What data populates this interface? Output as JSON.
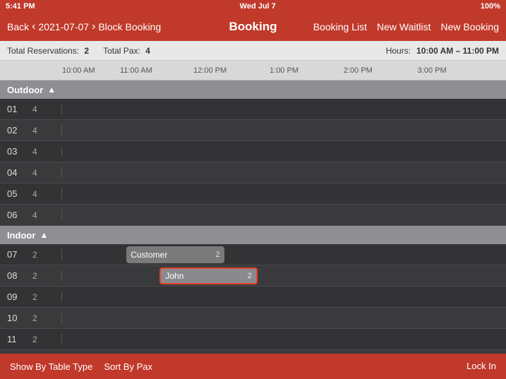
{
  "statusBar": {
    "time": "5:41 PM",
    "day": "Wed Jul 7",
    "signal": "WiFi",
    "battery": "100%"
  },
  "navBar": {
    "back": "Back",
    "date": "2021-07-07",
    "blockBooking": "Block Booking",
    "title": "Booking",
    "bookingList": "Booking List",
    "newWaitlist": "New Waitlist",
    "newBooking": "New Booking"
  },
  "infoBar": {
    "totalReservationsLabel": "Total Reservations:",
    "totalReservations": "2",
    "totalPaxLabel": "Total Pax:",
    "totalPax": "4",
    "hoursLabel": "Hours:",
    "hours": "10:00 AM – 11:00 PM"
  },
  "timelineHeader": {
    "times": [
      "10:00 AM",
      "11:00 AM",
      "12:00 PM",
      "1:00 PM",
      "2:00 PM",
      "3:00 PM"
    ]
  },
  "sections": [
    {
      "name": "Outdoor",
      "tables": [
        {
          "num": "01",
          "pax": 4,
          "bookings": []
        },
        {
          "num": "02",
          "pax": 4,
          "bookings": []
        },
        {
          "num": "03",
          "pax": 4,
          "bookings": []
        },
        {
          "num": "04",
          "pax": 4,
          "bookings": []
        },
        {
          "num": "05",
          "pax": 4,
          "bookings": []
        },
        {
          "num": "06",
          "pax": 4,
          "bookings": []
        }
      ]
    },
    {
      "name": "Indoor",
      "tables": [
        {
          "num": "07",
          "pax": 2,
          "bookings": [
            {
              "label": "Customer",
              "pax": 2,
              "startPct": 14.5,
              "widthPct": 22,
              "color": "#7a7a7a",
              "border": false
            }
          ]
        },
        {
          "num": "08",
          "pax": 2,
          "bookings": [
            {
              "label": "John",
              "pax": 2,
              "startPct": 22,
              "widthPct": 22,
              "color": "#8a8a8e",
              "border": true
            }
          ]
        },
        {
          "num": "09",
          "pax": 2,
          "bookings": []
        },
        {
          "num": "10",
          "pax": 2,
          "bookings": []
        },
        {
          "num": "11",
          "pax": 2,
          "bookings": []
        }
      ]
    }
  ],
  "bottomBar": {
    "showByTableType": "Show By Table Type",
    "sortByPax": "Sort By Pax",
    "lockIn": "Lock In"
  }
}
